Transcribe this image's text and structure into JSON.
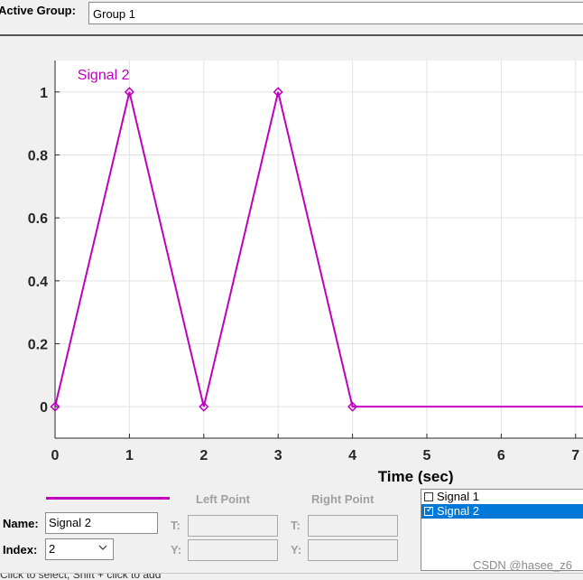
{
  "active_group": {
    "label": "Active Group:",
    "value": "Group 1"
  },
  "chart_data": {
    "type": "line",
    "title": "",
    "xlabel": "Time (sec)",
    "ylabel": "",
    "xlim": [
      0,
      7.1
    ],
    "ylim": [
      -0.1,
      1.1
    ],
    "x_ticks": [
      "0",
      "1",
      "2",
      "3",
      "4",
      "5",
      "6",
      "7"
    ],
    "y_ticks": [
      "0",
      "0.2",
      "0.4",
      "0.6",
      "0.8",
      "1"
    ],
    "grid": true,
    "series": [
      {
        "name": "Signal 2",
        "color": "#bf00bf",
        "marker": "diamond",
        "x": [
          0,
          1,
          2,
          3,
          4,
          7.1
        ],
        "y": [
          0,
          1,
          0,
          1,
          0,
          0
        ],
        "marked_points": 5
      }
    ]
  },
  "editor": {
    "left_point_title": "Left Point",
    "right_point_title": "Right Point",
    "name_label": "Name:",
    "name_value": "Signal 2",
    "index_label": "Index:",
    "index_value": "2",
    "t_label": "T:",
    "y_label": "Y:"
  },
  "signals_list": {
    "items": [
      {
        "label": "Signal 1",
        "checked": false,
        "selected": false
      },
      {
        "label": "Signal 2",
        "checked": true,
        "selected": true
      }
    ]
  },
  "status": {
    "text": "Click to select, Shift + click to add"
  },
  "watermark": "CSDN @hasee_z6"
}
